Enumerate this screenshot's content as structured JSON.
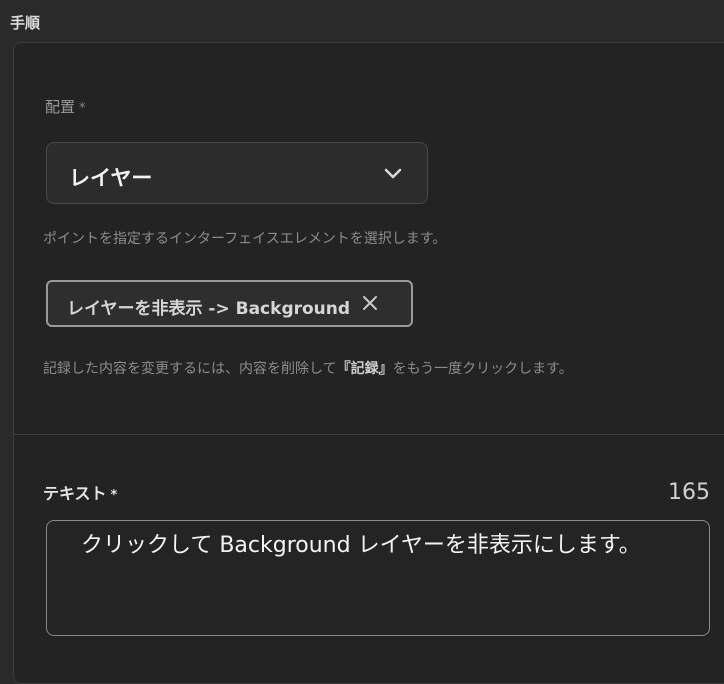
{
  "section": {
    "title": "手順"
  },
  "placement": {
    "label": "配置",
    "required_mark": "*",
    "selected_value": "レイヤー",
    "help_text": "ポイントを指定するインターフェイスエレメントを選択します。"
  },
  "recorded_chip": {
    "label": "レイヤーを非表示 -> Background"
  },
  "record_note": {
    "before": "記録した内容を変更するには、内容を削除して",
    "bold": "『記録』",
    "after": "をもう一度クリックします。"
  },
  "text_field": {
    "label": "テキスト",
    "required_mark": "*",
    "counter": "165",
    "value": "クリックして Background レイヤーを非表示にします。"
  },
  "icons": {
    "select_chevron": "chevron-down-icon",
    "chip_close": "close-icon"
  }
}
